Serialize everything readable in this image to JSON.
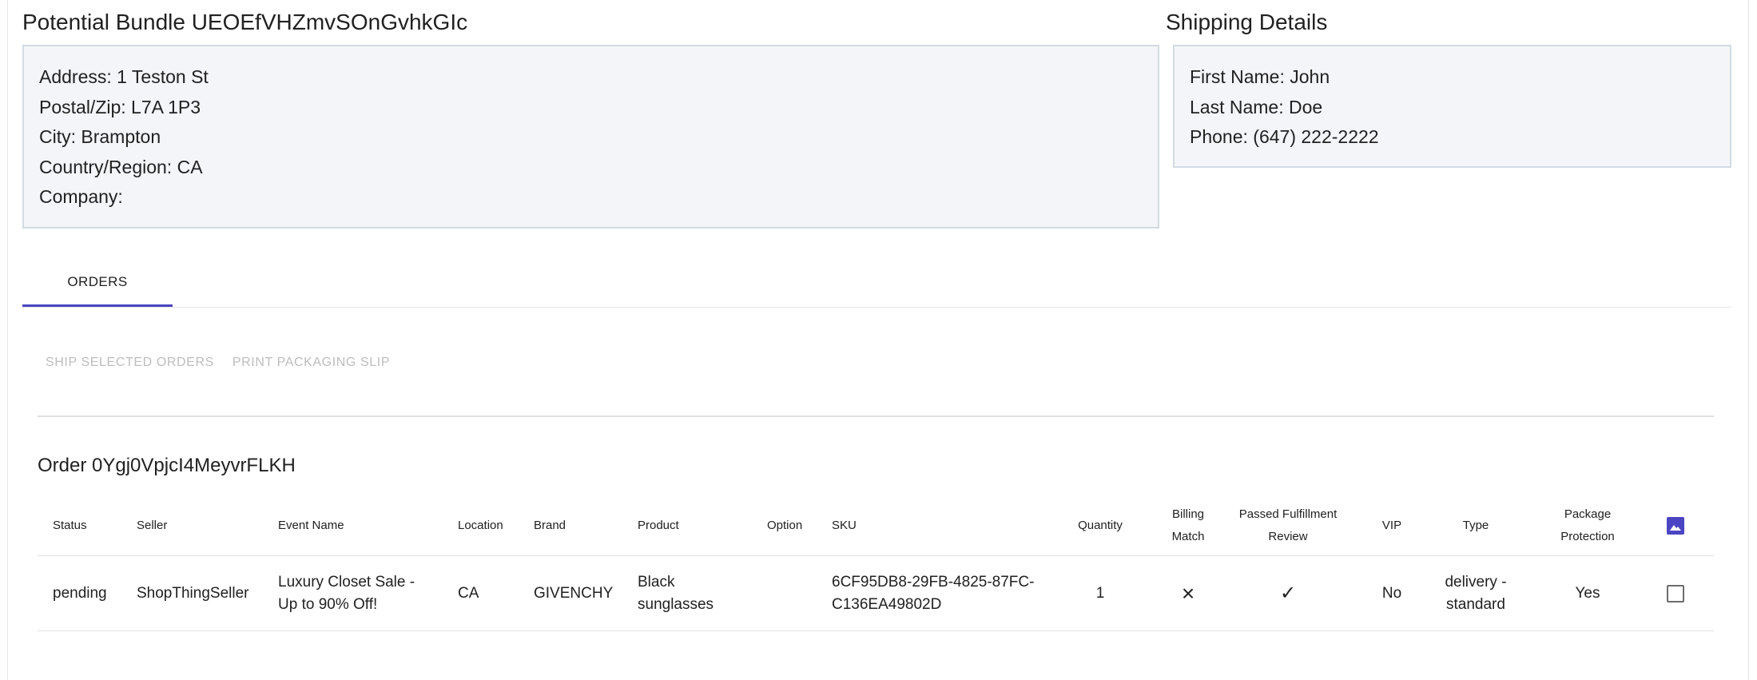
{
  "bundle": {
    "title": "Potential Bundle UEOEfVHZmvSOnGvhkGIc",
    "address_lines": [
      "Address: 1 Teston St",
      "Postal/Zip: L7A 1P3",
      "City: Brampton",
      "Country/Region: CA",
      "Company:"
    ]
  },
  "shipping": {
    "title": "Shipping Details",
    "lines": [
      "First Name: John",
      "Last Name: Doe",
      "Phone: (647) 222-2222"
    ]
  },
  "tabs": [
    {
      "label": "ORDERS",
      "active": true
    }
  ],
  "actions": {
    "ship_label": "SHIP SELECTED ORDERS",
    "print_label": "PRINT PACKAGING SLIP"
  },
  "order": {
    "title": "Order 0Ygj0VpjcI4MeyvrFLKH",
    "columns": {
      "status": "Status",
      "seller": "Seller",
      "event_name": "Event Name",
      "location": "Location",
      "brand": "Brand",
      "product": "Product",
      "option": "Option",
      "sku": "SKU",
      "quantity": "Quantity",
      "billing_match_1": "Billing",
      "billing_match_2": "Match",
      "passed_review_1": "Passed Fulfillment",
      "passed_review_2": "Review",
      "vip": "VIP",
      "type": "Type",
      "package_protection_1": "Package",
      "package_protection_2": "Protection",
      "image_icon": "image-icon"
    },
    "rows": [
      {
        "status": "pending",
        "seller": "ShopThingSeller",
        "event_name_1": "Luxury Closet Sale -",
        "event_name_2": "Up to 90% Off!",
        "location": "CA",
        "brand": "GIVENCHY",
        "product_1": "Black",
        "product_2": "sunglasses",
        "option": "",
        "sku_1": "6CF95DB8-29FB-4825-87FC-",
        "sku_2": "C136EA49802D",
        "quantity": "1",
        "billing_match": "×",
        "passed_review": "✓",
        "vip": "No",
        "type_1": "delivery -",
        "type_2": "standard",
        "package_protection": "Yes",
        "selected": false
      }
    ]
  },
  "colors": {
    "accent": "#4b45c3",
    "card_bg": "#f3f5f8",
    "card_border": "#d3dbe3",
    "disabled_text": "#bdbdbd"
  }
}
